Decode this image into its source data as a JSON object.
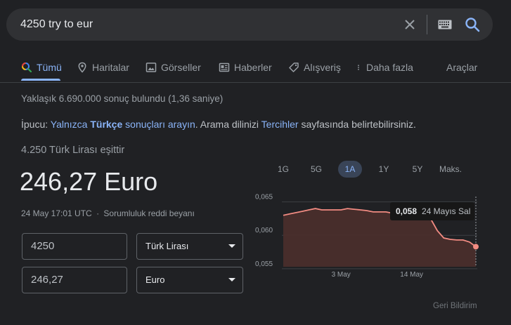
{
  "search": {
    "query": "4250 try to eur"
  },
  "tabs": [
    {
      "label": "Tümü"
    },
    {
      "label": "Haritalar"
    },
    {
      "label": "Görseller"
    },
    {
      "label": "Haberler"
    },
    {
      "label": "Alışveriş"
    },
    {
      "label": "Daha fazla"
    }
  ],
  "tools_label": "Araçlar",
  "result_stats": "Yaklaşık 6.690.000 sonuç bulundu (1,36 saniye)",
  "tip": {
    "prefix": "İpucu:",
    "link1_pre": "Yalnızca",
    "link1_bold": "Türkçe",
    "link1_post": "sonuçları arayın",
    "middle": ". Arama dilinizi",
    "link2": "Tercihler",
    "suffix": "sayfasında belirtebilirsiniz."
  },
  "converter": {
    "equals_label": "4.250 Türk Lirası eşittir",
    "result": "246,27 Euro",
    "timestamp": "24 May 17:01 UTC",
    "separator": "·",
    "disclaimer": "Sorumluluk reddi beyanı",
    "from_amount": "4250",
    "from_currency": "Türk Lirası",
    "to_amount": "246,27",
    "to_currency": "Euro"
  },
  "ranges": [
    {
      "label": "1G"
    },
    {
      "label": "5G"
    },
    {
      "label": "1A",
      "active": true
    },
    {
      "label": "1Y"
    },
    {
      "label": "5Y"
    },
    {
      "label": "Maks."
    }
  ],
  "feedback": "Geri Bildirim",
  "colors": {
    "accent": "#8ab4f8",
    "line": "#f28b82",
    "fill": "#4a2e2c"
  },
  "chart_data": {
    "type": "area",
    "y_tick_labels": [
      "0,065",
      "0,060",
      "0,055"
    ],
    "y_ticks": [
      0.065,
      0.06,
      0.055
    ],
    "ylim": [
      0.0553,
      0.0658
    ],
    "x_tick_labels": [
      "3 May",
      "14 May"
    ],
    "x": [
      "24 Apr",
      "25 Apr",
      "26 Apr",
      "27 Apr",
      "28 Apr",
      "29 Apr",
      "30 Apr",
      "1 May",
      "2 May",
      "3 May",
      "4 May",
      "5 May",
      "6 May",
      "7 May",
      "8 May",
      "9 May",
      "10 May",
      "11 May",
      "12 May",
      "13 May",
      "14 May",
      "15 May",
      "16 May",
      "17 May",
      "18 May",
      "19 May",
      "20 May",
      "21 May",
      "22 May",
      "23 May",
      "24 May"
    ],
    "values": [
      0.063,
      0.0632,
      0.0634,
      0.0636,
      0.0638,
      0.064,
      0.0638,
      0.0638,
      0.0638,
      0.0638,
      0.064,
      0.0639,
      0.0638,
      0.0637,
      0.0635,
      0.0635,
      0.0635,
      0.0633,
      0.063,
      0.0628,
      0.0628,
      0.0626,
      0.0625,
      0.0624,
      0.0607,
      0.0596,
      0.0594,
      0.0593,
      0.0593,
      0.059,
      0.0583
    ],
    "x_tick_index": [
      9,
      20
    ],
    "tooltip": {
      "value": "0,058",
      "label": "24 Mayıs Sal"
    },
    "grid": true
  }
}
